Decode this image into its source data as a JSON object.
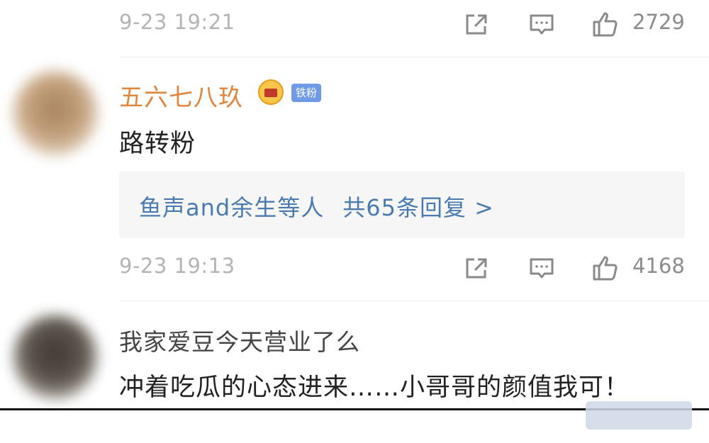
{
  "comments": [
    {
      "time": "9-23 19:21",
      "likes": "2729"
    },
    {
      "username": "五六七八玖",
      "badge_label": "铁粉",
      "text": "路转粉",
      "replies_names": "鱼声and余生等人",
      "replies_count": "共65条回复 >",
      "time": "9-23 19:13",
      "likes": "4168"
    },
    {
      "username": "我家爱豆今天营业了么",
      "text": "冲着吃瓜的心态进来……小哥哥的颜值我可！"
    }
  ],
  "icons": {
    "share": "share-icon",
    "comment": "comment-icon",
    "like": "thumb-up-icon"
  },
  "colors": {
    "username": "#e0873f",
    "reply_link": "#4a7bb0",
    "meta": "#b4b4b4"
  }
}
